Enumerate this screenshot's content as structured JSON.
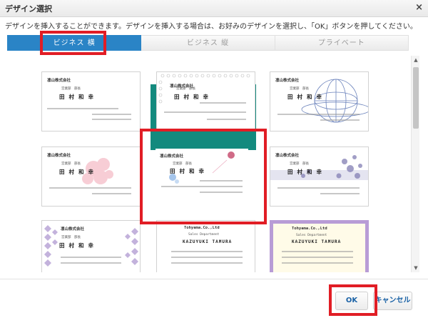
{
  "dialog": {
    "title": "デザイン選択",
    "close_label": "×"
  },
  "instruction": "デザインを挿入することができます。デザインを挿入する場合は、お好みのデザインを選択し、「OK」ボタンを押してください。",
  "tabs": [
    {
      "label": "ビジネス 横",
      "active": true
    },
    {
      "label": "ビジネス 縦",
      "active": false
    },
    {
      "label": "プライベート",
      "active": false
    }
  ],
  "cards": [
    {
      "company": "凛山株式会社",
      "dept": "営業部　部長",
      "name": "田村和幸",
      "style": "plain"
    },
    {
      "company": "凛山株式会社",
      "dept": "営業部　部長",
      "name": "田村和幸",
      "style": "dots"
    },
    {
      "company": "凛山株式会社",
      "dept": "営業部　部長",
      "name": "田村和幸",
      "style": "globe"
    },
    {
      "company": "凛山株式会社",
      "dept": "営業部　部長",
      "name": "田村和幸",
      "style": "flower"
    },
    {
      "company": "凛山株式会社",
      "dept": "営業部　部長",
      "name": "田村和幸",
      "style": "bubbles-selected"
    },
    {
      "company": "凛山株式会社",
      "dept": "営業部　部長",
      "name": "田村和幸",
      "style": "spheres"
    },
    {
      "company": "凛山株式会社",
      "dept": "営業部　部長",
      "name": "田村和幸",
      "style": "diamonds"
    },
    {
      "company": "Tohyama.Co.,Ltd",
      "dept": "Sales Department",
      "name": "KAZUYUKI TAMURA",
      "style": "english"
    },
    {
      "company": "Tohyama.Co.,Ltd",
      "dept": "Sales Department",
      "name": "KAZUYUKI TAMURA",
      "style": "english-frame"
    }
  ],
  "buttons": {
    "ok": "OK",
    "cancel": "キャンセル"
  },
  "colors": {
    "accent": "#2a84c6",
    "selection": "#138a7e",
    "highlight": "#e11d25"
  }
}
